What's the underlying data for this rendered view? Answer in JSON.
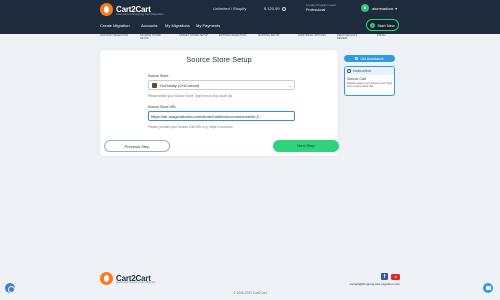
{
  "header": {
    "logo_text": "Cart2Cart",
    "logo_sub": "Automated Shopping Cart Migration",
    "package": "Unlimited / Shopify",
    "credits": "$ 120.99",
    "loyalty_label": "Loyalty Program Level",
    "loyalty_value": "Professional",
    "user_name": "alumnadora",
    "start_label": "Start New",
    "nav": [
      "Create Migration",
      "Accounts",
      "My Migrations",
      "My Payments"
    ]
  },
  "steps": [
    "ACCOUNT SELECTION",
    "SOURCE STORE SETUP",
    "TARGET STORE SETUP",
    "ENTITIES SELECTION",
    "MAPPING SETUP",
    "ADDITIONAL OPTIONS",
    "DEMO RESULTS REVIEW",
    "FINISH"
  ],
  "form": {
    "title": "Source Store Setup",
    "source_store_label": "Source Store",
    "source_store_value": "GoDaddy (OnCurrent)",
    "source_store_hint": "Please select your Source Store Type from a drop-down list.",
    "source_url_label": "Source Store URL",
    "source_url_value": "https://air-magicalkorea.com/store/hotels/woocommerce/id=2",
    "source_url_hint": "Please, provide your Source Cart URL e.g. https://.com.com",
    "prev_label": "Previous Step",
    "next_label": "Next Step"
  },
  "assistant": {
    "button_label": "Get Assistance",
    "panel_title": "Instruction",
    "panel_subtitle": "Source Cart",
    "panel_body": "Please select your Source Cart Type from a drop-down list."
  },
  "footer": {
    "logo_text": "Cart2Cart",
    "logo_sub": "Automated Shopping Cart Migration",
    "contact": "contact@shopping-cart-migration.com",
    "copyright": "© 2006-2021 Cart2Cart"
  }
}
